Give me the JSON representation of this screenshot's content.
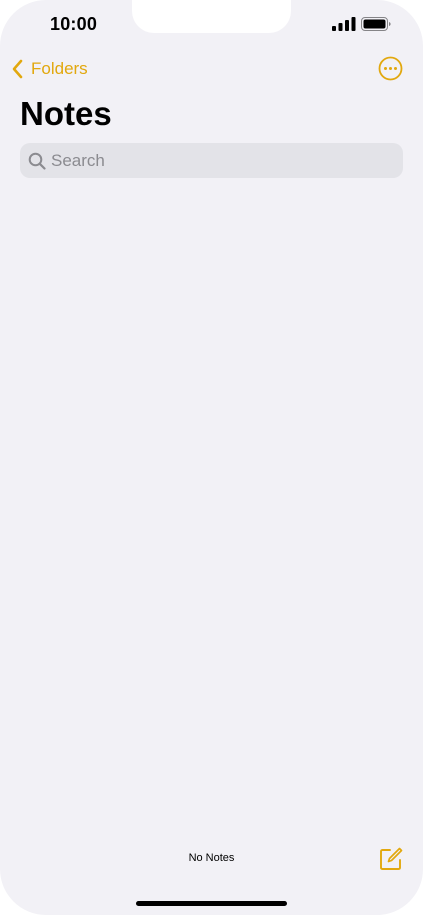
{
  "status_bar": {
    "time": "10:00",
    "icons": [
      "cellular-signal-icon",
      "battery-icon"
    ]
  },
  "nav": {
    "back_label": "Folders",
    "back_icon": "chevron-left-icon",
    "more_icon": "ellipsis-circle-icon"
  },
  "page": {
    "title": "Notes"
  },
  "search": {
    "placeholder": "Search",
    "icon": "magnifying-glass-icon"
  },
  "footer": {
    "note_count": "No Notes",
    "compose_icon": "compose-icon"
  },
  "colors": {
    "accent": "#e2a80e",
    "background": "#f2f1f6",
    "search_field": "#e3e3e8"
  }
}
